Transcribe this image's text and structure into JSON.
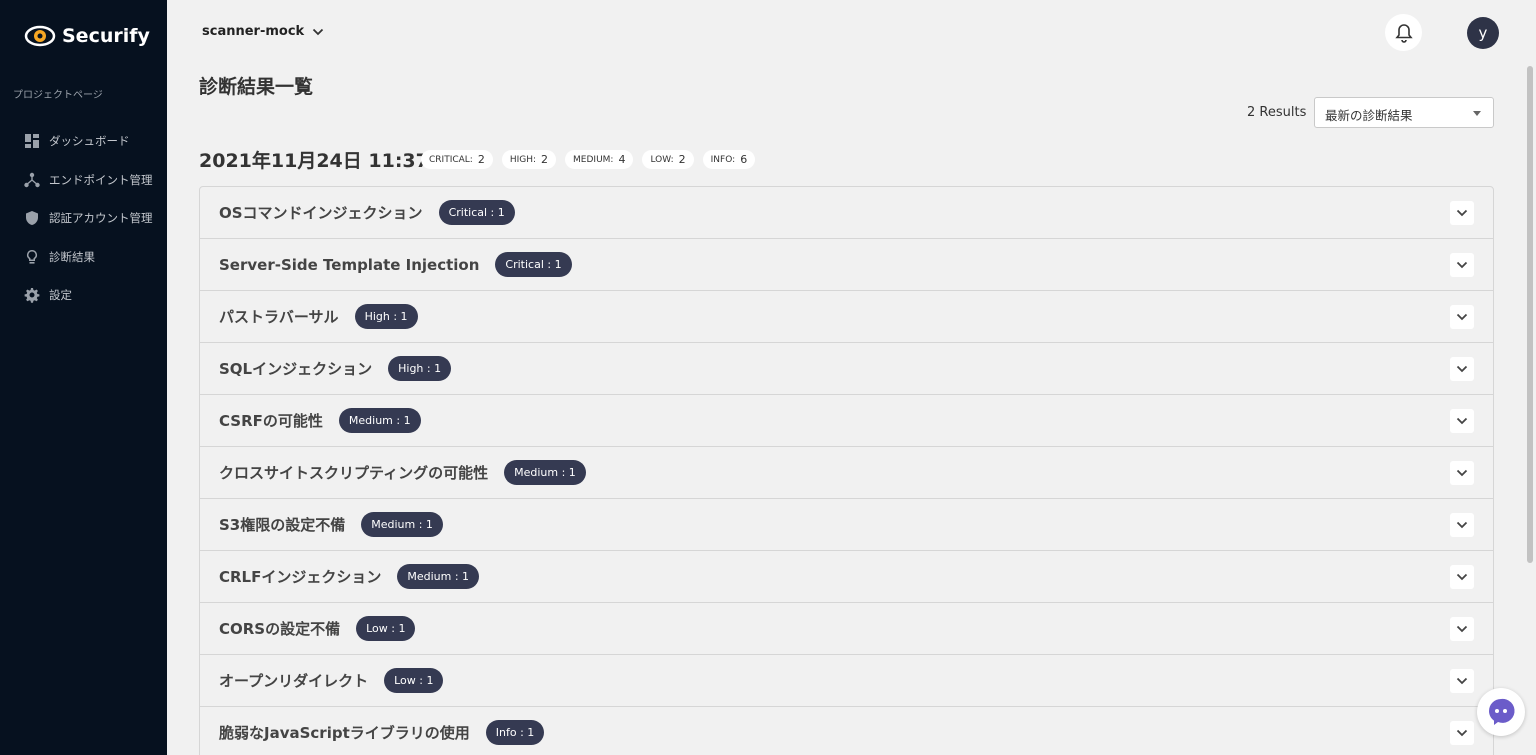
{
  "brand": {
    "name": "Securify"
  },
  "sidebar": {
    "section_label": "プロジェクトページ",
    "items": [
      {
        "label": "ダッシュボード",
        "icon": "dashboard-icon"
      },
      {
        "label": "エンドポイント管理",
        "icon": "endpoint-icon"
      },
      {
        "label": "認証アカウント管理",
        "icon": "shield-icon"
      },
      {
        "label": "診断結果",
        "icon": "lightbulb-icon"
      },
      {
        "label": "設定",
        "icon": "gear-icon"
      }
    ]
  },
  "header": {
    "project": "scanner-mock",
    "avatar_initial": "y"
  },
  "page": {
    "title": "診断結果一覧",
    "results_count": "2 Results",
    "sort_value": "最新の診断結果",
    "scan_date": "2021年11月24日 11:37"
  },
  "summary": [
    {
      "label": "CRITICAL:",
      "count": "2"
    },
    {
      "label": "HIGH:",
      "count": "2"
    },
    {
      "label": "MEDIUM:",
      "count": "4"
    },
    {
      "label": "LOW:",
      "count": "2"
    },
    {
      "label": "INFO:",
      "count": "6"
    }
  ],
  "findings": [
    {
      "title": "OSコマンドインジェクション",
      "badge": "Critical : 1"
    },
    {
      "title": "Server-Side Template Injection",
      "badge": "Critical : 1"
    },
    {
      "title": "パストラバーサル",
      "badge": "High : 1"
    },
    {
      "title": "SQLインジェクション",
      "badge": "High : 1"
    },
    {
      "title": "CSRFの可能性",
      "badge": "Medium : 1"
    },
    {
      "title": "クロスサイトスクリプティングの可能性",
      "badge": "Medium : 1"
    },
    {
      "title": "S3権限の設定不備",
      "badge": "Medium : 1"
    },
    {
      "title": "CRLFインジェクション",
      "badge": "Medium : 1"
    },
    {
      "title": "CORSの設定不備",
      "badge": "Low : 1"
    },
    {
      "title": "オープンリダイレクト",
      "badge": "Low : 1"
    },
    {
      "title": "脆弱なJavaScriptライブラリの使用",
      "badge": "Info : 1"
    }
  ],
  "colors": {
    "sidebar_bg": "#06111f",
    "badge_bg": "#353a52",
    "accent": "#f5a623"
  }
}
